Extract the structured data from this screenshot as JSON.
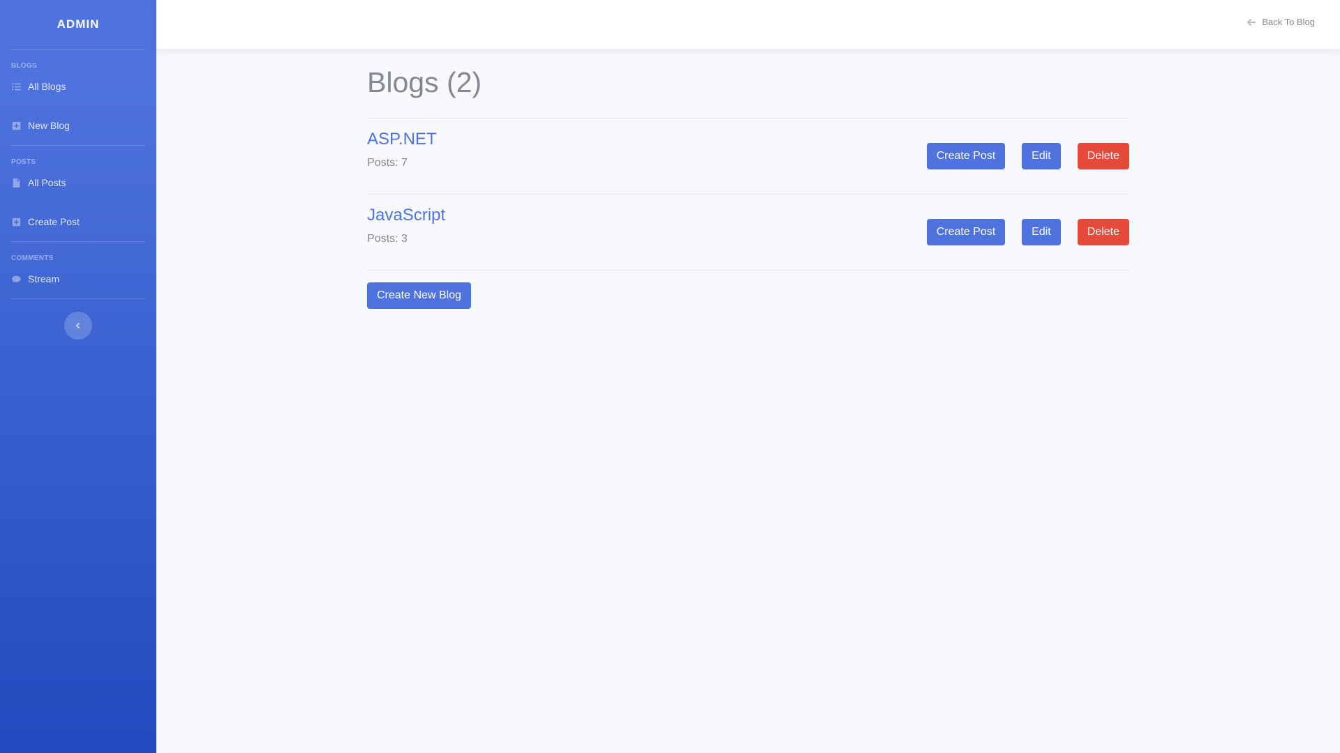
{
  "sidebar": {
    "brand": "ADMIN",
    "sections": [
      {
        "heading": "BLOGS",
        "items": [
          {
            "label": "All Blogs",
            "icon": "list-icon"
          },
          {
            "label": "New Blog",
            "icon": "plus-square-icon"
          }
        ]
      },
      {
        "heading": "POSTS",
        "items": [
          {
            "label": "All Posts",
            "icon": "file-icon"
          },
          {
            "label": "Create Post",
            "icon": "plus-square-icon"
          }
        ]
      },
      {
        "heading": "COMMENTS",
        "items": [
          {
            "label": "Stream",
            "icon": "comment-icon"
          }
        ]
      }
    ],
    "toggle_icon": "chevron-left-icon"
  },
  "topbar": {
    "back_label": "Back To Blog",
    "back_icon": "arrow-left-icon"
  },
  "main": {
    "title": "Blogs (2)",
    "blogs": [
      {
        "name": "ASP.NET",
        "posts": "Posts: 7"
      },
      {
        "name": "JavaScript",
        "posts": "Posts: 3"
      }
    ],
    "row_buttons": {
      "create_post": "Create Post",
      "edit": "Edit",
      "delete": "Delete"
    },
    "create_blog_label": "Create New Blog"
  },
  "colors": {
    "primary": "#4e73df",
    "danger": "#e74a3b",
    "text_muted": "#858796",
    "background": "#f8f9fc"
  }
}
